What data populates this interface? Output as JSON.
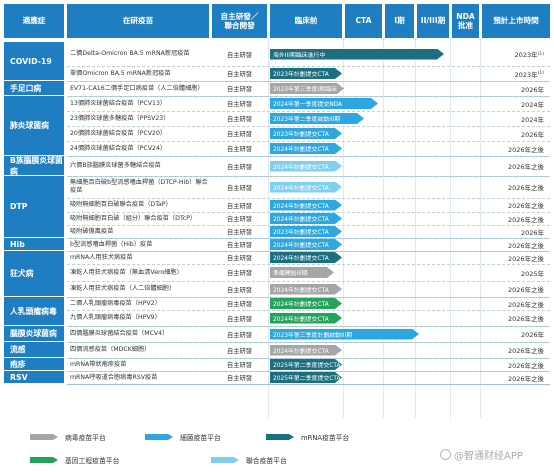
{
  "header": {
    "indication": "適應症",
    "candidate": "在研疫苗",
    "mode": "自主研發／聯合開發",
    "preclinical": "臨床前",
    "cta": "CTA",
    "phase1": "I期",
    "phase23": "II/III期",
    "nda": "NDA批准",
    "eta": "預計上市時間"
  },
  "indications": [
    "COVID-19",
    "手足口病",
    "肺炎球菌病",
    "B族腦膜炎球菌病",
    "DTP",
    "Hib",
    "狂犬病",
    "人乳頭瘤病毒",
    "腦膜炎球菌病",
    "流感",
    "疱疹",
    "RSV"
  ],
  "rows": [
    {
      "candidate": "二價Delta-Omicron BA.5 mRNA新冠疫苗",
      "mode": "自主研發",
      "bar": "海外III期臨床進行中",
      "platform": "mrna",
      "eta": "2023年",
      "note": "(1)"
    },
    {
      "candidate": "單價Omicron BA.5 mRNA新冠疫苗",
      "mode": "自主研發",
      "bar": "2023年計劃提交CTA",
      "platform": "mrna",
      "eta": "2023年",
      "note": "(1)"
    },
    {
      "candidate": "EV71-CA16二價手足口病疫苗（人二倍體細胞）",
      "mode": "自主研發",
      "bar": "2023年第三季度I期臨床",
      "platform": "virus",
      "eta": "2026年",
      "note": ""
    },
    {
      "candidate": "13價肺炎球菌結合疫苗（PCV13）",
      "mode": "自主研發",
      "bar": "2024年第一季度提交NDA",
      "platform": "bacteria",
      "eta": "2024年",
      "note": ""
    },
    {
      "candidate": "23價肺炎球菌多糖疫苗（PPSV23）",
      "mode": "自主研發",
      "bar": "2023年第二季度啟動III期",
      "platform": "bacteria",
      "eta": "2024年",
      "note": ""
    },
    {
      "candidate": "20價肺炎球菌結合疫苗（PCV20）",
      "mode": "自主研發",
      "bar": "2023年計劃提交CTA",
      "platform": "bacteria",
      "eta": "2026年",
      "note": ""
    },
    {
      "candidate": "24價肺炎球菌結合疫苗（PCV24）",
      "mode": "自主研發",
      "bar": "2024年計劃提交CTA",
      "platform": "bacteria",
      "eta": "2026年之後",
      "note": ""
    },
    {
      "candidate": "六價B族腦膜炎球菌多糖結合疫苗",
      "mode": "自主研發",
      "bar": "2024年計劃提交CTA",
      "platform": "combo",
      "eta": "2026年之後",
      "note": ""
    },
    {
      "candidate": "無細胞百白破b型流感嗜血桿菌（DTCP-Hib）聯合疫苗",
      "mode": "自主研發",
      "bar": "2024年計劃提交CTA",
      "platform": "combo",
      "eta": "2026年之後",
      "note": ""
    },
    {
      "candidate": "吸附無細胞百白破聯合疫苗（DTaP）",
      "mode": "自主研發",
      "bar": "2024年計劃提交CTA",
      "platform": "bacteria",
      "eta": "2026年之後",
      "note": ""
    },
    {
      "candidate": "吸附無細胞百白破（組分）聯合疫苗（DTcP）",
      "mode": "自主研發",
      "bar": "2024年計劃提交CTA",
      "platform": "bacteria",
      "eta": "2026年之後",
      "note": ""
    },
    {
      "candidate": "吸附破傷風疫苗",
      "mode": "自主研發",
      "bar": "2023年計劃提交CTA",
      "platform": "bacteria",
      "eta": "2026年",
      "note": ""
    },
    {
      "candidate": "b型流感嗜血桿菌（Hib）疫苗",
      "mode": "自主研發",
      "bar": "2024年計劃提交CTA",
      "platform": "bacteria",
      "eta": "2026年之後",
      "note": ""
    },
    {
      "candidate": "mRNA人用狂犬病疫苗",
      "mode": "自主研發",
      "bar": "2024年計劃提交CTA",
      "platform": "mrna",
      "eta": "2026年之後",
      "note": ""
    },
    {
      "candidate": "凍乾人用狂犬病疫苗（無血清Vero細胞）",
      "mode": "自主研發",
      "bar": "準備開始III期",
      "platform": "virus",
      "eta": "2025年",
      "note": ""
    },
    {
      "candidate": "凍乾人用狂犬病疫苗（人二倍體細胞）",
      "mode": "自主研發",
      "bar": "2024年計劃提交CTA",
      "platform": "virus",
      "eta": "2026年之後",
      "note": ""
    },
    {
      "candidate": "二價人乳頭瘤病毒疫苗（HPV2）",
      "mode": "自主研發",
      "bar": "2024年計劃提交CTA",
      "platform": "gene",
      "eta": "2026年之後",
      "note": ""
    },
    {
      "candidate": "九價人乳頭瘤病毒疫苗（HPV9）",
      "mode": "自主研發",
      "bar": "2024年計劃提交CTA",
      "platform": "gene",
      "eta": "2026年之後",
      "note": ""
    },
    {
      "candidate": "四價腦膜炎球菌結合疫苗（MCV4）",
      "mode": "自主研發",
      "bar": "2023年第三季度計劃啟動III期",
      "platform": "bacteria",
      "eta": "2026年",
      "note": ""
    },
    {
      "candidate": "四價流感疫苗（MDCK細胞）",
      "mode": "自主研發",
      "bar": "2024年計劃提交CTA",
      "platform": "virus",
      "eta": "2026年之後",
      "note": ""
    },
    {
      "candidate": "mRNA帶狀疱疹疫苗",
      "mode": "自主研發",
      "bar": "2025年第二季度提交CTA",
      "platform": "mrna",
      "eta": "2026年之後",
      "note": ""
    },
    {
      "candidate": "mRNA呼吸道合胞病毒RSV疫苗",
      "mode": "自主研發",
      "bar": "2025年第二季度提交CTA",
      "platform": "mrna",
      "eta": "2026年之後",
      "note": ""
    }
  ],
  "legend": [
    {
      "label": "病毒疫苗平台",
      "color": "#a6a6a6"
    },
    {
      "label": "細菌疫苗平台",
      "color": "#2ea7e0"
    },
    {
      "label": "mRNA疫苗平台",
      "color": "#1b6f80"
    },
    {
      "label": "基因工程疫苗平台",
      "color": "#25a35a"
    },
    {
      "label": "聯合疫苗平台",
      "color": "#7fd0f0"
    }
  ],
  "platform_colors": {
    "virus": "#a6a6a6",
    "bacteria": "#2ea7e0",
    "mrna": "#1b6f80",
    "gene": "#25a35a",
    "combo": "#7fd0f0"
  },
  "progress": {
    "hint": "bar end stage",
    "values": [
      0.89,
      0.2,
      0.18,
      0.53,
      0.5,
      0.2,
      0.2,
      0.2,
      0.2,
      0.2,
      0.2,
      0.2,
      0.2,
      0.2,
      0.3,
      0.2,
      0.2,
      0.2,
      0.7,
      0.2,
      0.2,
      0.2
    ]
  },
  "watermark": "@智通财经APP"
}
